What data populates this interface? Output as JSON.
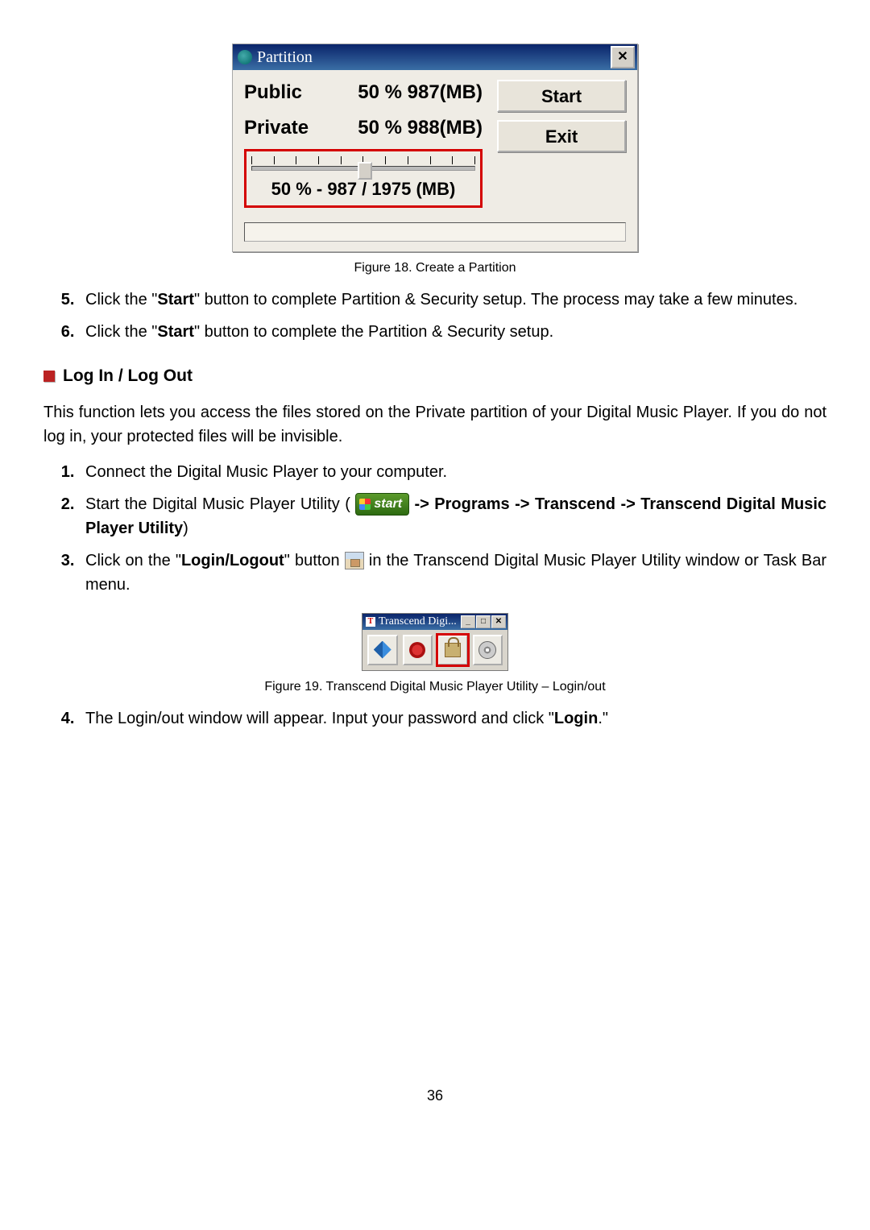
{
  "fig18": {
    "title": "Partition",
    "public_label": "Public",
    "public_value": "50 %  987(MB)",
    "private_label": "Private",
    "private_value": "50 %  988(MB)",
    "start_btn": "Start",
    "exit_btn": "Exit",
    "slider_caption": "50 % - 987 / 1975 (MB)",
    "caption": "Figure 18. Create a Partition"
  },
  "steps_a": {
    "s5_pre": "Click the \"",
    "s5_bold": "Start",
    "s5_post": "\" button to complete Partition & Security setup. The process may take a few minutes.",
    "s6_pre": "Click the \"",
    "s6_bold": "Start",
    "s6_post": "\" button to complete the Partition & Security setup."
  },
  "section_heading": "Log In / Log Out",
  "intro_para": "This function lets you access the files stored on the Private partition of your Digital Music Player. If you do not log in, your protected files will be invisible.",
  "steps_b": {
    "s1": "Connect the Digital Music Player to your computer.",
    "s2_pre": "Start the Digital Music Player Utility (",
    "start_label": "start",
    "s2_bold": " -> Programs -> Transcend -> Transcend Digital Music Player Utility",
    "s2_post": ")",
    "s3_pre": "Click on the \"",
    "s3_bold": "Login/Logout",
    "s3_mid": "\" button ",
    "s3_post": " in the Transcend Digital Music Player Utility window or Task Bar menu.",
    "s4_pre": "The Login/out window will appear. Input your password and click \"",
    "s4_bold": "Login",
    "s4_post": ".\""
  },
  "fig19": {
    "title": "Transcend Digi...",
    "caption": "Figure 19. Transcend Digital Music Player Utility – Login/out"
  },
  "page_number": "36"
}
